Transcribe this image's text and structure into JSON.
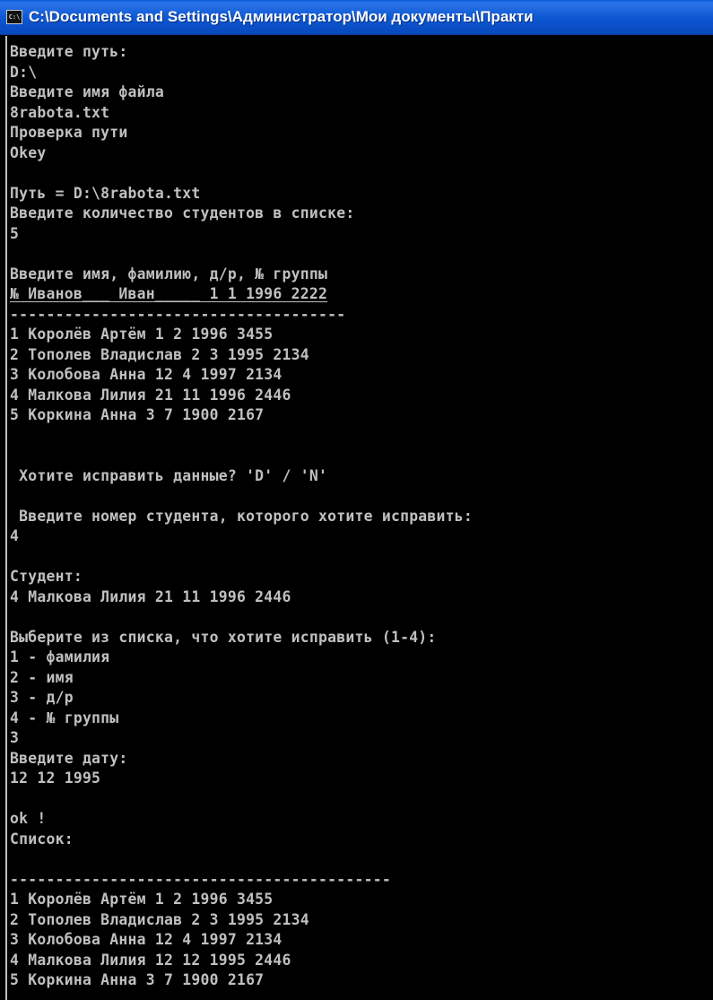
{
  "window": {
    "title": "C:\\Documents and Settings\\Администратор\\Мои документы\\Практи",
    "icon": "cmd-icon",
    "icon_text": "C:\\",
    "colors": {
      "titlebar": "#0c56d2",
      "background": "#000000",
      "text": "#c0c0c0"
    }
  },
  "console": {
    "lines": [
      "Введите путь:",
      "D:\\",
      "Введите имя файла",
      "8rabota.txt",
      "Проверка пути",
      "Okey",
      "",
      "Путь = D:\\8rabota.txt",
      "Введите количество студентов в списке:",
      "5",
      "",
      "Введите имя, фамилию, д/р, № группы",
      "№ Иванов___ Иван_____ 1 1 1996 2222",
      "-------------------------------------",
      "1 Королёв Артём 1 2 1996 3455",
      "2 Тополев Владислав 2 3 1995 2134",
      "3 Колобова Анна 12 4 1997 2134",
      "4 Малкова Лилия 21 11 1996 2446",
      "5 Коркина Анна 3 7 1900 2167",
      "",
      "",
      " Хотите исправить данные? 'D' / 'N'",
      "",
      " Введите номер студента, которого хотите исправить:",
      "4",
      "",
      "Студент:",
      "4 Малкова Лилия 21 11 1996 2446",
      "",
      "Выберите из списка, что хотите исправить (1-4):",
      "1 - фамилия",
      "2 - имя",
      "3 - д/р",
      "4 - № группы",
      "3",
      "Введите дату:",
      "12 12 1995",
      "",
      "ok !",
      "Список:",
      "",
      "------------------------------------------",
      "1 Королёв Артём 1 2 1996 3455",
      "2 Тополев Владислав 2 3 1995 2134",
      "3 Колобова Анна 12 4 1997 2134",
      "4 Малкова Лилия 12 12 1995 2446",
      "5 Коркина Анна 3 7 1900 2167"
    ]
  }
}
